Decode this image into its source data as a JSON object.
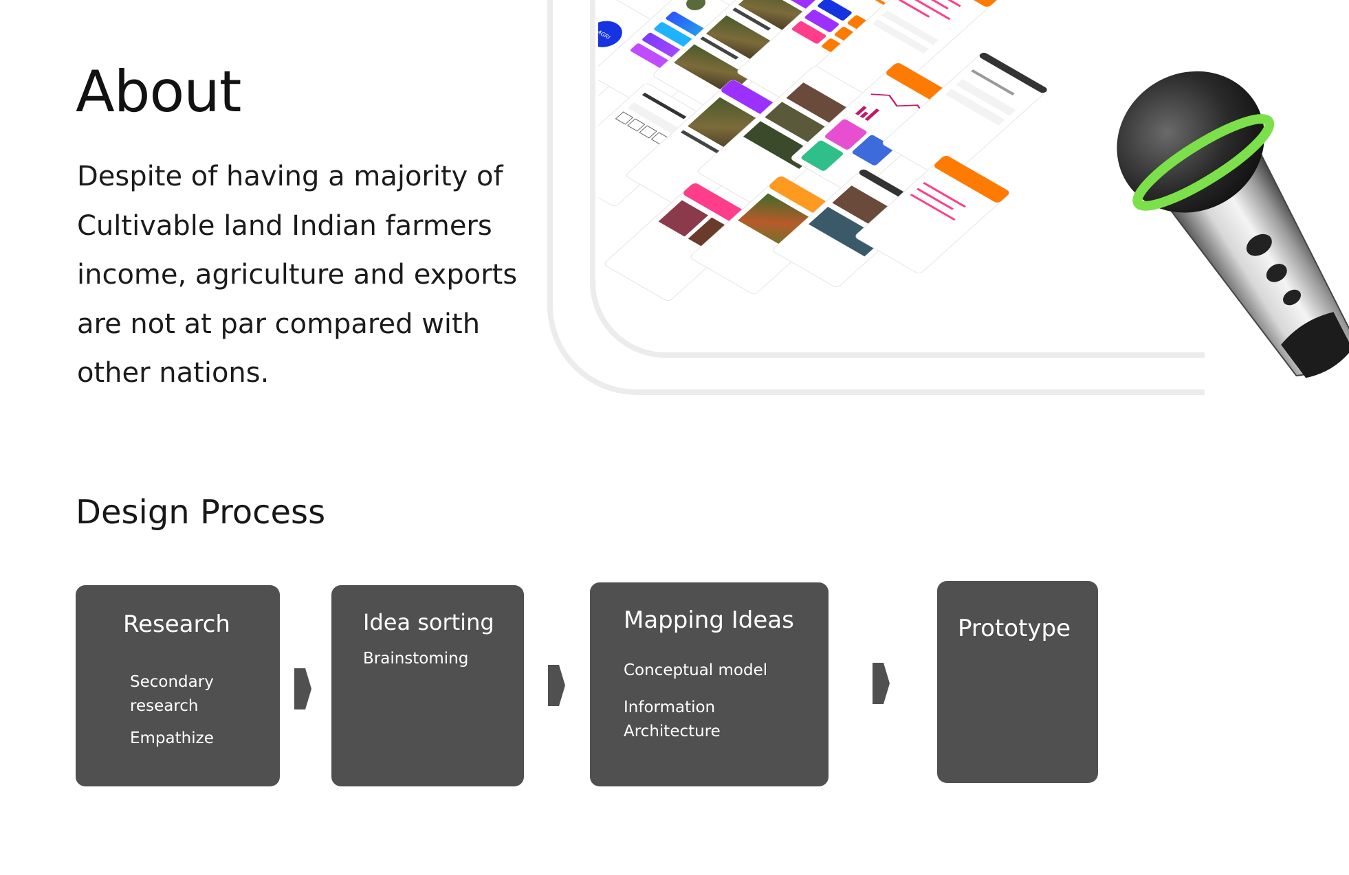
{
  "about": {
    "title": "About",
    "body": "Despite of having a majority of Cultivable land Indian farmers income, agriculture and exports are not at par compared with other nations."
  },
  "design_process": {
    "title": "Design Process",
    "steps": [
      {
        "title": "Research",
        "items": [
          "Secondary research",
          "Empathize"
        ]
      },
      {
        "title": "Idea sorting",
        "items": [
          "Brainstoming"
        ]
      },
      {
        "title": "Mapping Ideas",
        "items": [
          "Conceptual model",
          "Information Architecture"
        ]
      },
      {
        "title": "Prototype",
        "items": []
      }
    ]
  },
  "mockup": {
    "logo_text": "AGRI"
  },
  "colors": {
    "card_background": "#505050",
    "frame_stroke": "#ececec",
    "accent_purple": "#9b30ff",
    "accent_orange": "#ff7a00",
    "accent_pink": "#ff3d8b",
    "accent_blue": "#1533e0",
    "device_ring_green": "#7be04a"
  },
  "icons": [
    "chevron-right-icon"
  ]
}
